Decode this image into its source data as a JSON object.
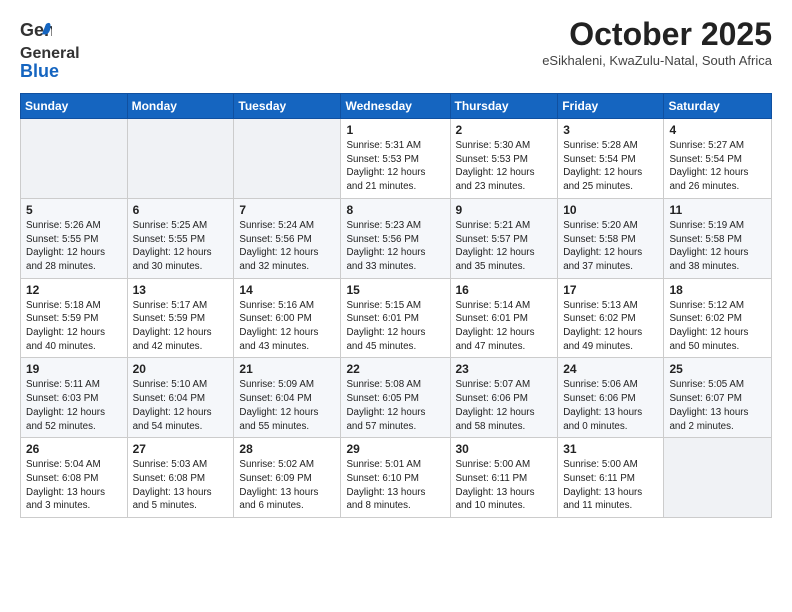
{
  "header": {
    "logo": {
      "line1": "General",
      "line2": "Blue"
    },
    "title": "October 2025",
    "subtitle": "eSikhaleni, KwaZulu-Natal, South Africa"
  },
  "weekdays": [
    "Sunday",
    "Monday",
    "Tuesday",
    "Wednesday",
    "Thursday",
    "Friday",
    "Saturday"
  ],
  "weeks": [
    [
      {
        "day": "",
        "info": ""
      },
      {
        "day": "",
        "info": ""
      },
      {
        "day": "",
        "info": ""
      },
      {
        "day": "1",
        "info": "Sunrise: 5:31 AM\nSunset: 5:53 PM\nDaylight: 12 hours\nand 21 minutes."
      },
      {
        "day": "2",
        "info": "Sunrise: 5:30 AM\nSunset: 5:53 PM\nDaylight: 12 hours\nand 23 minutes."
      },
      {
        "day": "3",
        "info": "Sunrise: 5:28 AM\nSunset: 5:54 PM\nDaylight: 12 hours\nand 25 minutes."
      },
      {
        "day": "4",
        "info": "Sunrise: 5:27 AM\nSunset: 5:54 PM\nDaylight: 12 hours\nand 26 minutes."
      }
    ],
    [
      {
        "day": "5",
        "info": "Sunrise: 5:26 AM\nSunset: 5:55 PM\nDaylight: 12 hours\nand 28 minutes."
      },
      {
        "day": "6",
        "info": "Sunrise: 5:25 AM\nSunset: 5:55 PM\nDaylight: 12 hours\nand 30 minutes."
      },
      {
        "day": "7",
        "info": "Sunrise: 5:24 AM\nSunset: 5:56 PM\nDaylight: 12 hours\nand 32 minutes."
      },
      {
        "day": "8",
        "info": "Sunrise: 5:23 AM\nSunset: 5:56 PM\nDaylight: 12 hours\nand 33 minutes."
      },
      {
        "day": "9",
        "info": "Sunrise: 5:21 AM\nSunset: 5:57 PM\nDaylight: 12 hours\nand 35 minutes."
      },
      {
        "day": "10",
        "info": "Sunrise: 5:20 AM\nSunset: 5:58 PM\nDaylight: 12 hours\nand 37 minutes."
      },
      {
        "day": "11",
        "info": "Sunrise: 5:19 AM\nSunset: 5:58 PM\nDaylight: 12 hours\nand 38 minutes."
      }
    ],
    [
      {
        "day": "12",
        "info": "Sunrise: 5:18 AM\nSunset: 5:59 PM\nDaylight: 12 hours\nand 40 minutes."
      },
      {
        "day": "13",
        "info": "Sunrise: 5:17 AM\nSunset: 5:59 PM\nDaylight: 12 hours\nand 42 minutes."
      },
      {
        "day": "14",
        "info": "Sunrise: 5:16 AM\nSunset: 6:00 PM\nDaylight: 12 hours\nand 43 minutes."
      },
      {
        "day": "15",
        "info": "Sunrise: 5:15 AM\nSunset: 6:01 PM\nDaylight: 12 hours\nand 45 minutes."
      },
      {
        "day": "16",
        "info": "Sunrise: 5:14 AM\nSunset: 6:01 PM\nDaylight: 12 hours\nand 47 minutes."
      },
      {
        "day": "17",
        "info": "Sunrise: 5:13 AM\nSunset: 6:02 PM\nDaylight: 12 hours\nand 49 minutes."
      },
      {
        "day": "18",
        "info": "Sunrise: 5:12 AM\nSunset: 6:02 PM\nDaylight: 12 hours\nand 50 minutes."
      }
    ],
    [
      {
        "day": "19",
        "info": "Sunrise: 5:11 AM\nSunset: 6:03 PM\nDaylight: 12 hours\nand 52 minutes."
      },
      {
        "day": "20",
        "info": "Sunrise: 5:10 AM\nSunset: 6:04 PM\nDaylight: 12 hours\nand 54 minutes."
      },
      {
        "day": "21",
        "info": "Sunrise: 5:09 AM\nSunset: 6:04 PM\nDaylight: 12 hours\nand 55 minutes."
      },
      {
        "day": "22",
        "info": "Sunrise: 5:08 AM\nSunset: 6:05 PM\nDaylight: 12 hours\nand 57 minutes."
      },
      {
        "day": "23",
        "info": "Sunrise: 5:07 AM\nSunset: 6:06 PM\nDaylight: 12 hours\nand 58 minutes."
      },
      {
        "day": "24",
        "info": "Sunrise: 5:06 AM\nSunset: 6:06 PM\nDaylight: 13 hours\nand 0 minutes."
      },
      {
        "day": "25",
        "info": "Sunrise: 5:05 AM\nSunset: 6:07 PM\nDaylight: 13 hours\nand 2 minutes."
      }
    ],
    [
      {
        "day": "26",
        "info": "Sunrise: 5:04 AM\nSunset: 6:08 PM\nDaylight: 13 hours\nand 3 minutes."
      },
      {
        "day": "27",
        "info": "Sunrise: 5:03 AM\nSunset: 6:08 PM\nDaylight: 13 hours\nand 5 minutes."
      },
      {
        "day": "28",
        "info": "Sunrise: 5:02 AM\nSunset: 6:09 PM\nDaylight: 13 hours\nand 6 minutes."
      },
      {
        "day": "29",
        "info": "Sunrise: 5:01 AM\nSunset: 6:10 PM\nDaylight: 13 hours\nand 8 minutes."
      },
      {
        "day": "30",
        "info": "Sunrise: 5:00 AM\nSunset: 6:11 PM\nDaylight: 13 hours\nand 10 minutes."
      },
      {
        "day": "31",
        "info": "Sunrise: 5:00 AM\nSunset: 6:11 PM\nDaylight: 13 hours\nand 11 minutes."
      },
      {
        "day": "",
        "info": ""
      }
    ]
  ]
}
